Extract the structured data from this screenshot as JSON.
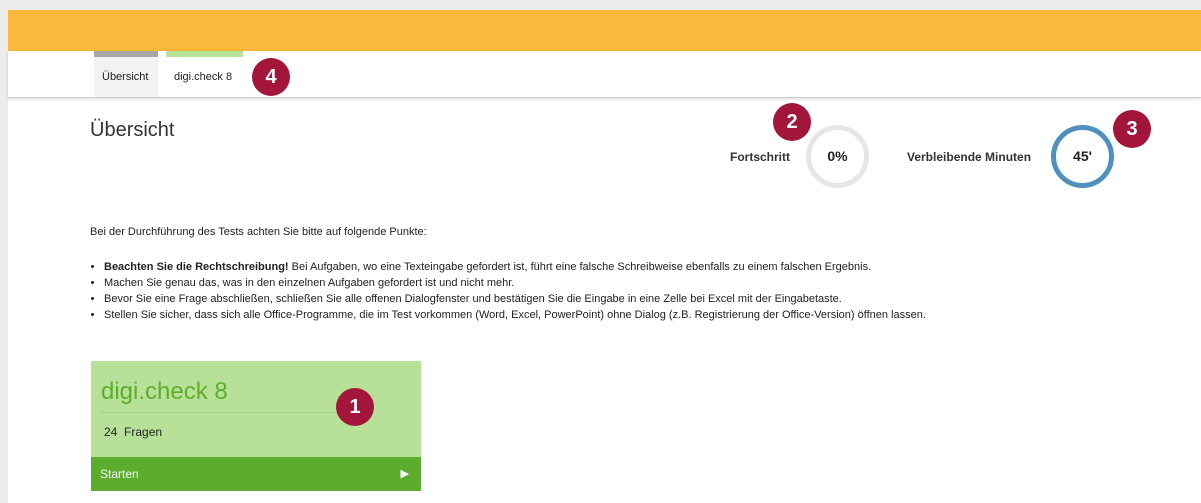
{
  "tabs": [
    {
      "label": "Übersicht"
    },
    {
      "label": "digi.check 8"
    }
  ],
  "badges": [
    "1",
    "2",
    "3",
    "4"
  ],
  "page_title": "Übersicht",
  "progress": {
    "label": "Fortschritt",
    "value_text": "0%",
    "value": 0
  },
  "remaining": {
    "label": "Verbleibende Minuten",
    "value_text": "45'"
  },
  "intro": "Bei der Durchführung des Tests achten Sie bitte auf folgende Punkte:",
  "points": [
    {
      "bold": "Beachten Sie die Rechtschreibung!",
      "text": " Bei Aufgaben, wo eine Texteingabe gefordert ist, führt eine falsche Schreibweise ebenfalls zu einem falschen Ergebnis."
    },
    {
      "bold": "",
      "text": "Machen Sie genau das, was in den einzelnen Aufgaben gefordert ist und nicht mehr."
    },
    {
      "bold": "",
      "text": "Bevor Sie eine Frage abschließen, schließen Sie alle offenen Dialogfenster und bestätigen Sie die Eingabe in eine Zelle bei Excel mit der Eingabetaste."
    },
    {
      "bold": "",
      "text": "Stellen Sie sicher, dass sich alle Office-Programme, die im Test vorkommen (Word, Excel, PowerPoint) ohne Dialog (z.B. Registrierung der Office-Version) öffnen lassen."
    }
  ],
  "card": {
    "title": "digi.check 8",
    "count": "24",
    "count_label": "Fragen",
    "start_label": "Starten",
    "start_icon": "play-icon"
  },
  "colors": {
    "header_orange": "#fbb93b",
    "badge_red": "#a3153b",
    "card_green_light": "#b7e199",
    "card_green_dark": "#5cad2e",
    "ring_blue": "#4f90bf"
  }
}
